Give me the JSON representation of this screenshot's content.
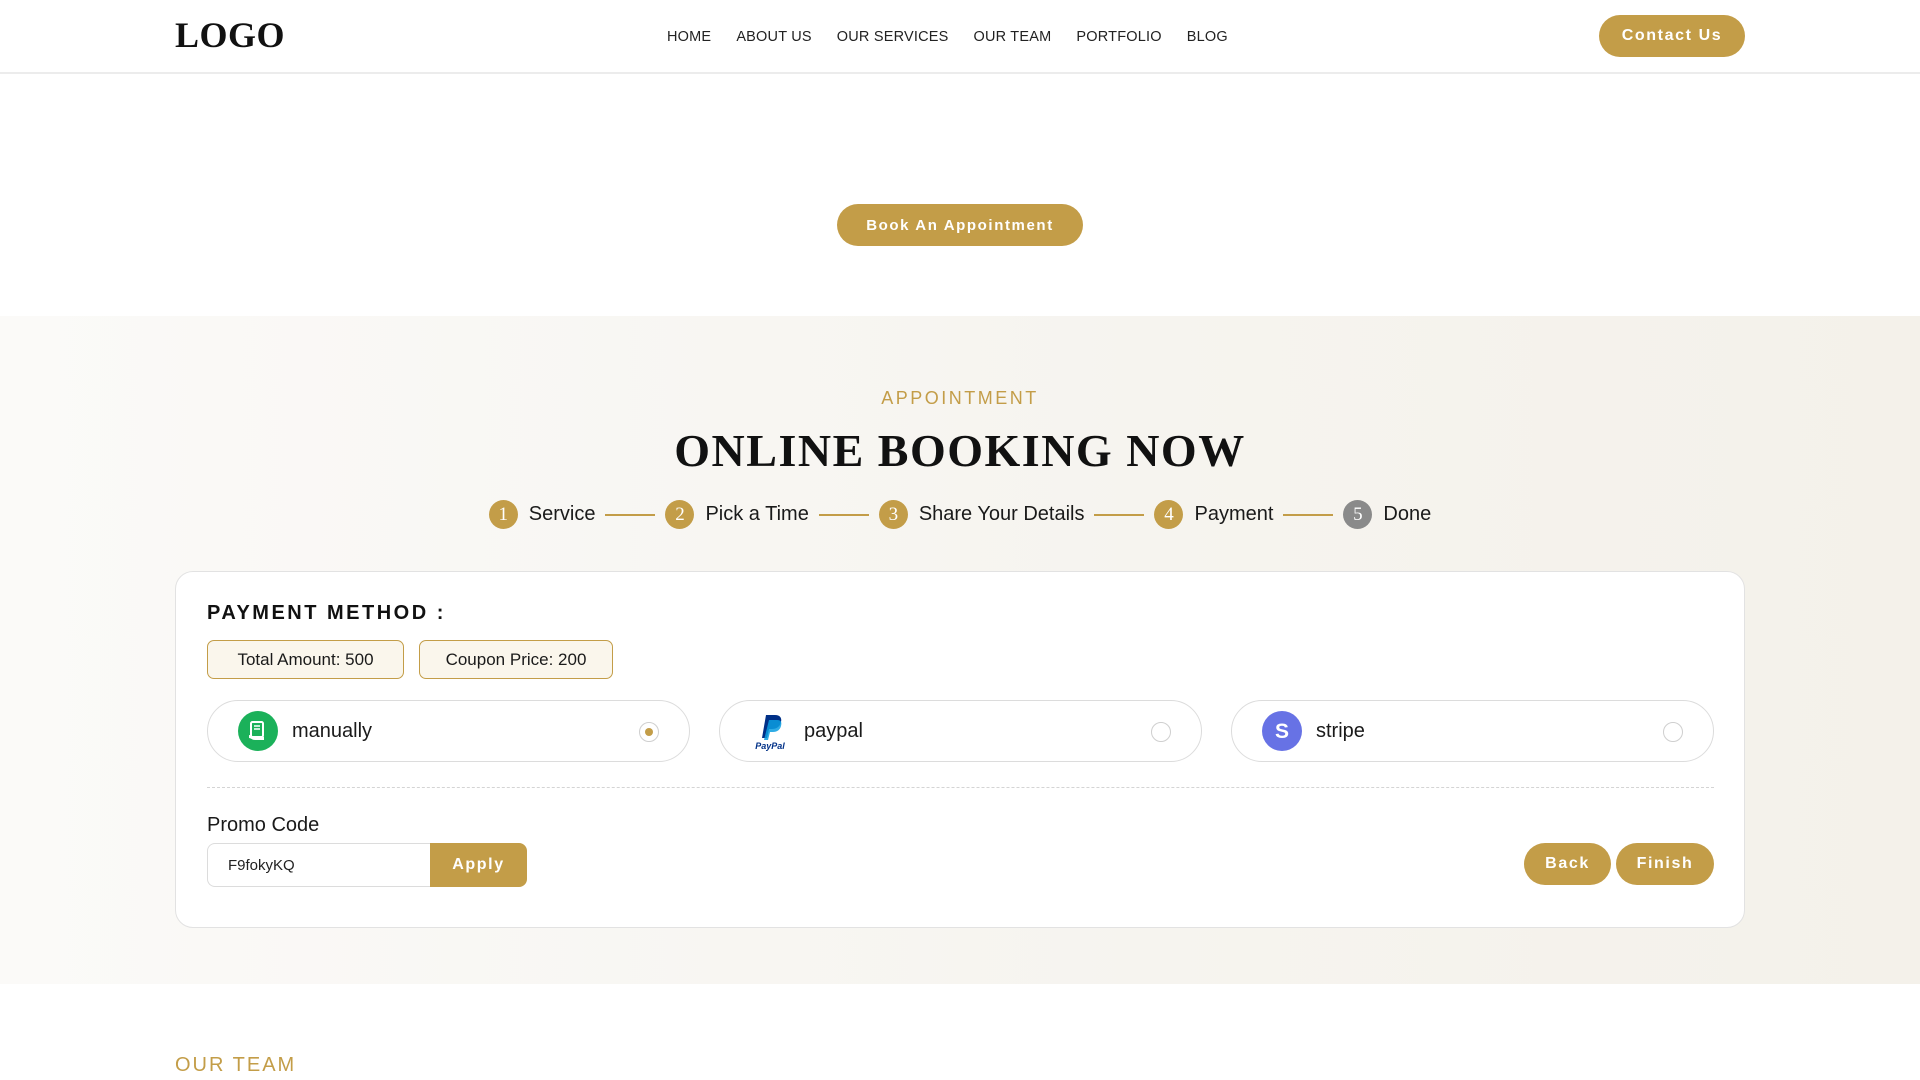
{
  "header": {
    "logo": "LOGO",
    "nav": [
      "HOME",
      "ABOUT US",
      "OUR SERVICES",
      "OUR TEAM",
      "PORTFOLIO",
      "BLOG"
    ],
    "contact_label": "Contact Us"
  },
  "hero": {
    "book_label": "Book An Appointment"
  },
  "booking": {
    "subtitle": "APPOINTMENT",
    "title": "ONLINE BOOKING NOW",
    "steps": [
      {
        "num": "1",
        "label": "Service",
        "state": "done"
      },
      {
        "num": "2",
        "label": "Pick a Time",
        "state": "done"
      },
      {
        "num": "3",
        "label": "Share Your Details",
        "state": "done"
      },
      {
        "num": "4",
        "label": "Payment",
        "state": "active"
      },
      {
        "num": "5",
        "label": "Done",
        "state": "pending"
      }
    ],
    "payment": {
      "heading": "PAYMENT METHOD :",
      "total_amount": "Total Amount: 500",
      "coupon_price": "Coupon Price: 200",
      "methods": [
        {
          "label": "manually",
          "icon": "cash-icon",
          "selected": true
        },
        {
          "label": "paypal",
          "icon": "paypal-icon",
          "selected": false
        },
        {
          "label": "stripe",
          "icon": "stripe-icon",
          "selected": false
        }
      ],
      "promo_label": "Promo Code",
      "promo_value": "F9fokyKQ",
      "apply_label": "Apply",
      "back_label": "Back",
      "finish_label": "Finish"
    }
  },
  "team": {
    "label": "OUR TEAM"
  },
  "colors": {
    "accent": "#c39d48",
    "pending_step": "#8a8a8a",
    "manual_icon": "#1bb15a",
    "stripe_icon": "#6772e5"
  }
}
